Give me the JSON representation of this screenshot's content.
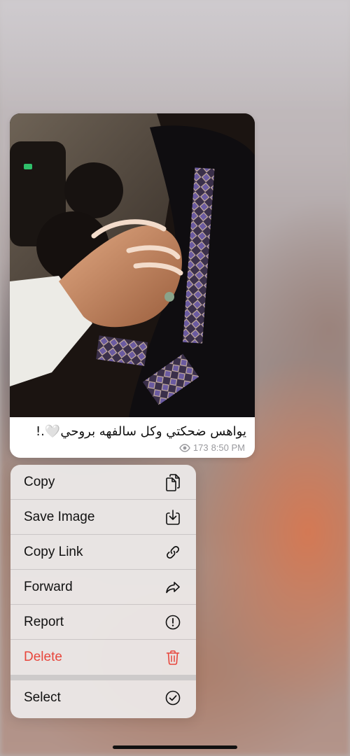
{
  "message": {
    "caption": "يواهس ضحكتي وكل سالفهه بروحي🤍.!",
    "views": "173",
    "time": "8:50 PM",
    "photo_description_icon": "photo"
  },
  "menu": {
    "items": [
      {
        "label": "Copy",
        "icon": "copy-icon"
      },
      {
        "label": "Save Image",
        "icon": "save-image-icon"
      },
      {
        "label": "Copy Link",
        "icon": "link-icon"
      },
      {
        "label": "Forward",
        "icon": "forward-icon"
      },
      {
        "label": "Report",
        "icon": "report-icon"
      },
      {
        "label": "Delete",
        "icon": "trash-icon"
      }
    ],
    "select": {
      "label": "Select",
      "icon": "checkmark-circle-icon"
    }
  },
  "colors": {
    "danger": "#e8463c",
    "meta_text": "#9a9a9e"
  }
}
